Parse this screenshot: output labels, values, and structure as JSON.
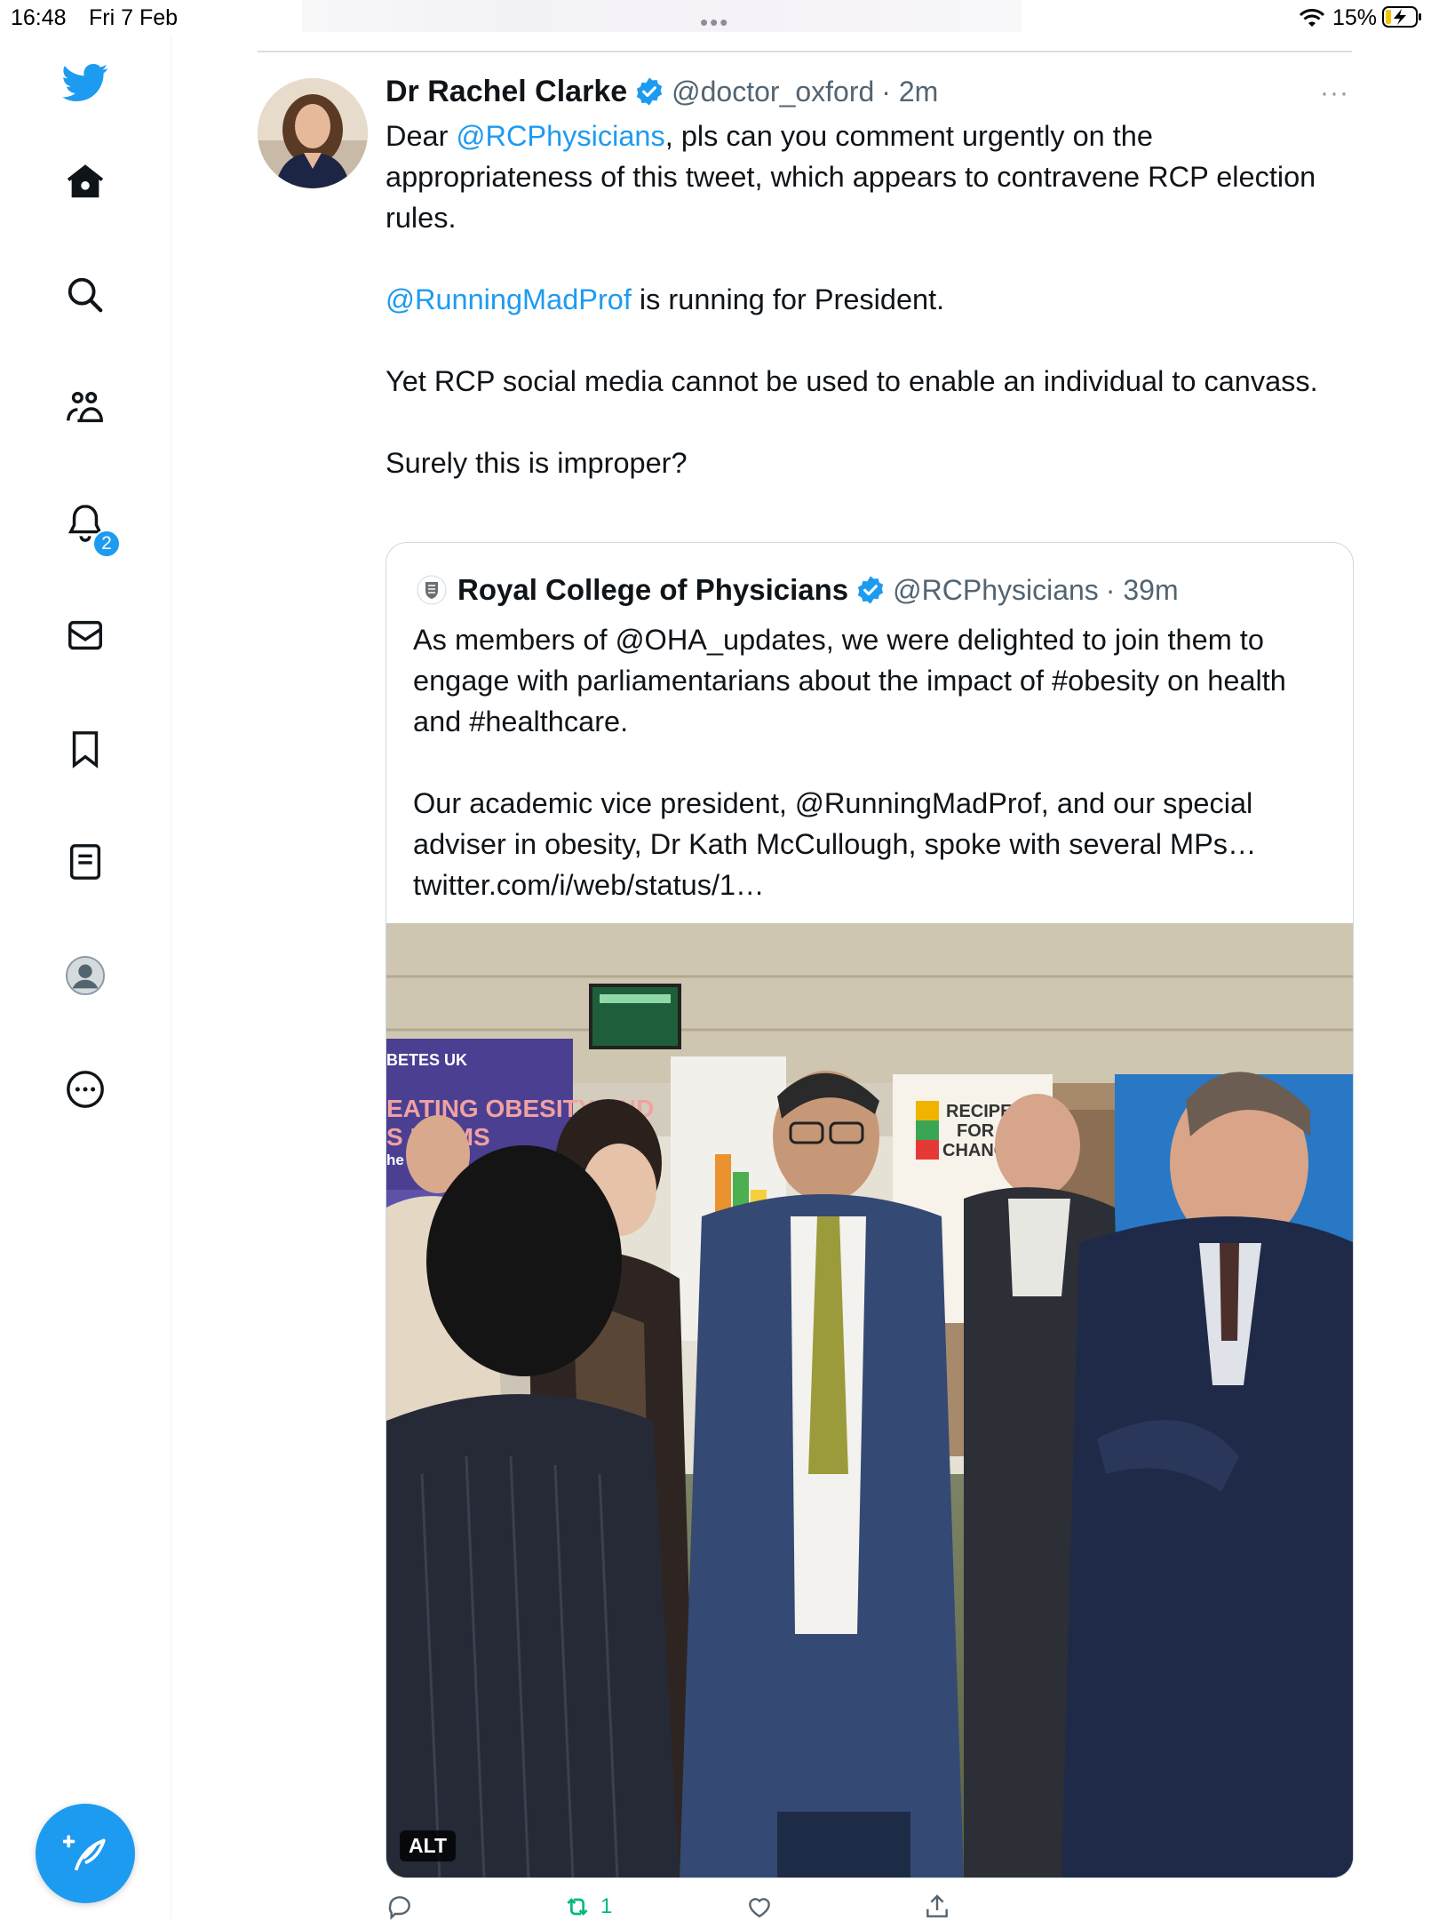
{
  "status_bar": {
    "time": "16:48",
    "date": "Fri 7 Feb",
    "battery": "15%"
  },
  "sidebar": {
    "notification_count": "2",
    "items": [
      "twitter-logo",
      "home-icon",
      "search-icon",
      "communities-icon",
      "notifications-icon",
      "messages-icon",
      "bookmarks-icon",
      "lists-icon",
      "profile-icon",
      "more-icon"
    ]
  },
  "tweet": {
    "author_name": "Dr Rachel Clarke",
    "author_handle": "@doctor_oxford",
    "time": "· 2m",
    "more": "···",
    "body": {
      "p1_pre": "Dear ",
      "p1_mention": "@RCPhysicians",
      "p1_post": ", pls can you comment urgently on the appropriateness of this tweet, which appears to contravene RCP election rules.",
      "p2_mention": "@RunningMadProf",
      "p2_post": " is running for President.",
      "p3": "Yet RCP social media cannot be used to enable an individual to canvass.",
      "p4": "Surely this is improper?"
    }
  },
  "quote": {
    "author_name": "Royal College of Physicians",
    "author_handle": "@RCPhysicians",
    "time": "· 39m",
    "p1": "As members of @OHA_updates, we were delighted to join them to engage with parliamentarians about the impact of #obesity on health and #healthcare.",
    "p2": "Our academic vice president, @RunningMadProf, and our special adviser in obesity, Dr Kath McCullough, spoke with several MPs…",
    "p3": "twitter.com/i/web/status/1…",
    "alt_label": "ALT",
    "photo_signs": {
      "banner_top": "BETES UK",
      "banner_main": "EATING OBESITY AND",
      "banner_sub": "S H     RMS",
      "banner_small": "he       loss",
      "poster_r1": "RECIPE",
      "poster_r2": "FOR",
      "poster_r3": "CHANGE"
    }
  },
  "actions": {
    "retweet_count": "1"
  },
  "colors": {
    "accent": "#1d9bf0",
    "text": "#0f1419",
    "secondary_text": "#536471",
    "border": "#cfd9de"
  }
}
